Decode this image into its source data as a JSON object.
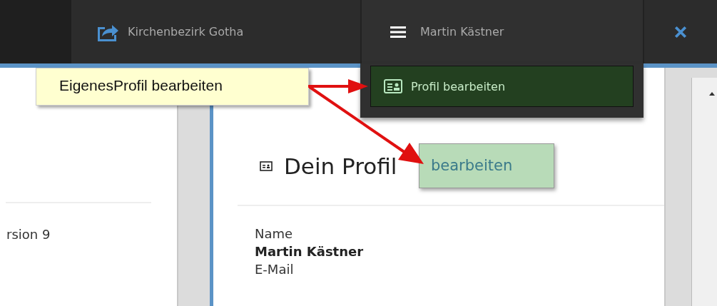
{
  "topbar": {
    "organization": {
      "label": "Kirchenbezirk Gotha"
    },
    "user_menu": {
      "label": "Martin Kästner",
      "expanded": true,
      "items": [
        {
          "label": "Profil bearbeiten",
          "selected": true
        }
      ]
    }
  },
  "left_panel": {
    "text": "rsion 9"
  },
  "profile": {
    "title": "Dein Profil",
    "fields": [
      {
        "label": "Name",
        "value": "Martin Kästner"
      },
      {
        "label": "E-Mail"
      }
    ]
  },
  "annotations": [
    {
      "kind": "callout",
      "text": "EigenesProfil bearbeiten"
    },
    {
      "kind": "highlight",
      "text": "bearbeiten"
    }
  ]
}
